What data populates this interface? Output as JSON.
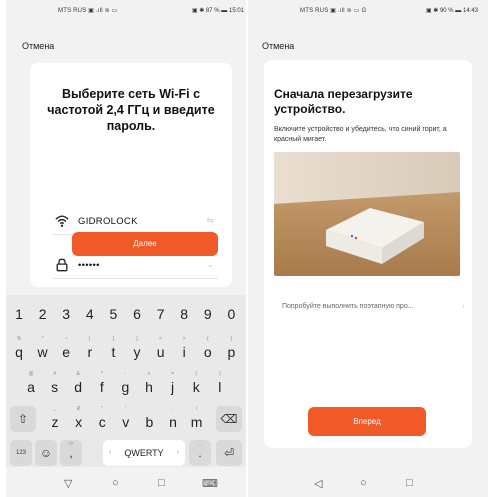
{
  "left": {
    "status": {
      "left": "MTS RUS ▣ .ıll ≋ ▭",
      "right": "▣ ✱ 87 % ▬ 15:01"
    },
    "cancel": "Отмена",
    "title": "Выберите сеть Wi-Fi с частотой 2,4 ГГц и введите пароль.",
    "ssid": "GIDROLOCK",
    "password": "••••••",
    "next_button": "Далее",
    "keyboard": {
      "row1": [
        {
          "k": "1",
          "h": ""
        },
        {
          "k": "2",
          "h": ""
        },
        {
          "k": "3",
          "h": ""
        },
        {
          "k": "4",
          "h": ""
        },
        {
          "k": "5",
          "h": ""
        },
        {
          "k": "6",
          "h": ""
        },
        {
          "k": "7",
          "h": ""
        },
        {
          "k": "8",
          "h": ""
        },
        {
          "k": "9",
          "h": ""
        },
        {
          "k": "0",
          "h": ""
        }
      ],
      "row2": [
        {
          "k": "q",
          "h": "%"
        },
        {
          "k": "w",
          "h": "^"
        },
        {
          "k": "e",
          "h": "~"
        },
        {
          "k": "r",
          "h": "|"
        },
        {
          "k": "t",
          "h": "["
        },
        {
          "k": "y",
          "h": "]"
        },
        {
          "k": "u",
          "h": "<"
        },
        {
          "k": "i",
          "h": ">"
        },
        {
          "k": "o",
          "h": "{"
        },
        {
          "k": "p",
          "h": "}"
        }
      ],
      "row3": [
        {
          "k": "a",
          "h": "@"
        },
        {
          "k": "s",
          "h": "#"
        },
        {
          "k": "d",
          "h": "&"
        },
        {
          "k": "f",
          "h": "*"
        },
        {
          "k": "g",
          "h": "-"
        },
        {
          "k": "h",
          "h": "+"
        },
        {
          "k": "j",
          "h": "="
        },
        {
          "k": "k",
          "h": "("
        },
        {
          "k": "l",
          "h": ")"
        }
      ],
      "row4": [
        {
          "k": "z",
          "h": "_"
        },
        {
          "k": "x",
          "h": "₽"
        },
        {
          "k": "c",
          "h": "\""
        },
        {
          "k": "v",
          "h": "'"
        },
        {
          "k": "b",
          "h": ":"
        },
        {
          "k": "n",
          "h": ";"
        },
        {
          "k": "m",
          "h": "/"
        }
      ],
      "shift": "⇧",
      "backspace": "⌫",
      "numbers_key": "123",
      "emoji_key": "☺",
      "comma_key": ",",
      "comma_hint": "!?",
      "space_label": "QWERTY",
      "space_left": "‹",
      "space_right": "›",
      "period_key": ".",
      "period_hint": "...",
      "enter": "⏎"
    },
    "nav": [
      "▽",
      "○",
      "□",
      "⌨"
    ]
  },
  "right": {
    "status": {
      "left": "MTS RUS ▣ .ıll ≋ ▭ G",
      "right": "▣ ✱ 90 % ▬ 14:43"
    },
    "cancel": "Отмена",
    "title": "Сначала перезагрузите устройство.",
    "description": "Включите устройство и убедитесь, что синий горит, а красный мигает.",
    "try_link": "Попробуйте выполнить поэтапную про...",
    "forward_button": "Вперед",
    "nav": [
      "◁",
      "○",
      "□"
    ]
  }
}
